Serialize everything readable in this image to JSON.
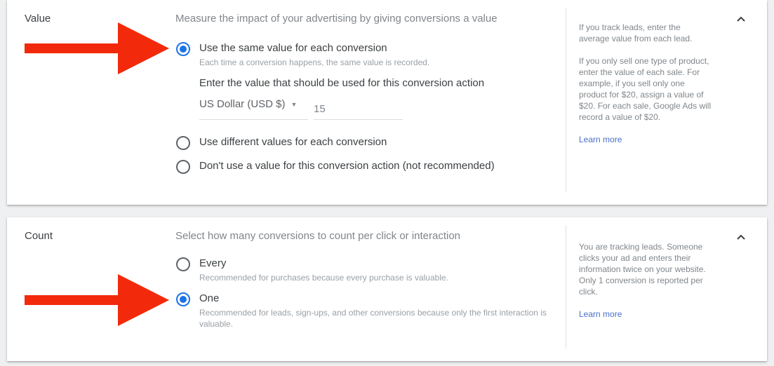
{
  "value_section": {
    "label": "Value",
    "description": "Measure the impact of your advertising by giving conversions a value",
    "options": [
      {
        "label": "Use the same value for each conversion",
        "sub": "Each time a conversion happens, the same value is recorded.",
        "checked": true
      },
      {
        "label": "Use different values for each conversion",
        "sub": "",
        "checked": false
      },
      {
        "label": "Don't use a value for this conversion action (not recommended)",
        "sub": "",
        "checked": false
      }
    ],
    "value_prompt": "Enter the value that should be used for this conversion action",
    "currency": "US Dollar (USD $)",
    "amount": "15",
    "help": [
      "If you track leads, enter the average value from each lead.",
      "If you only sell one type of product, enter the value of each sale. For example, if you sell only one product for $20, assign a value of $20. For each sale, Google Ads will record a value of $20."
    ],
    "learn_more": "Learn more"
  },
  "count_section": {
    "label": "Count",
    "description": "Select how many conversions to count per click or interaction",
    "options": [
      {
        "label": "Every",
        "sub": "Recommended for purchases because every purchase is valuable.",
        "checked": false
      },
      {
        "label": "One",
        "sub": "Recommended for leads, sign-ups, and other conversions because only the first interaction is valuable.",
        "checked": true
      }
    ],
    "help": [
      "You are tracking leads. Someone clicks your ad and enters their information twice on your website. Only 1 conversion is reported per click."
    ],
    "learn_more": "Learn more"
  },
  "icons": {
    "collapse": "chevron-up-icon",
    "annotation": "red-arrow-icon",
    "dropdown": "caret-down-icon"
  },
  "colors": {
    "accent": "#1a73e8",
    "annotation_arrow": "#f22a0b",
    "link": "#4a6ec8"
  }
}
